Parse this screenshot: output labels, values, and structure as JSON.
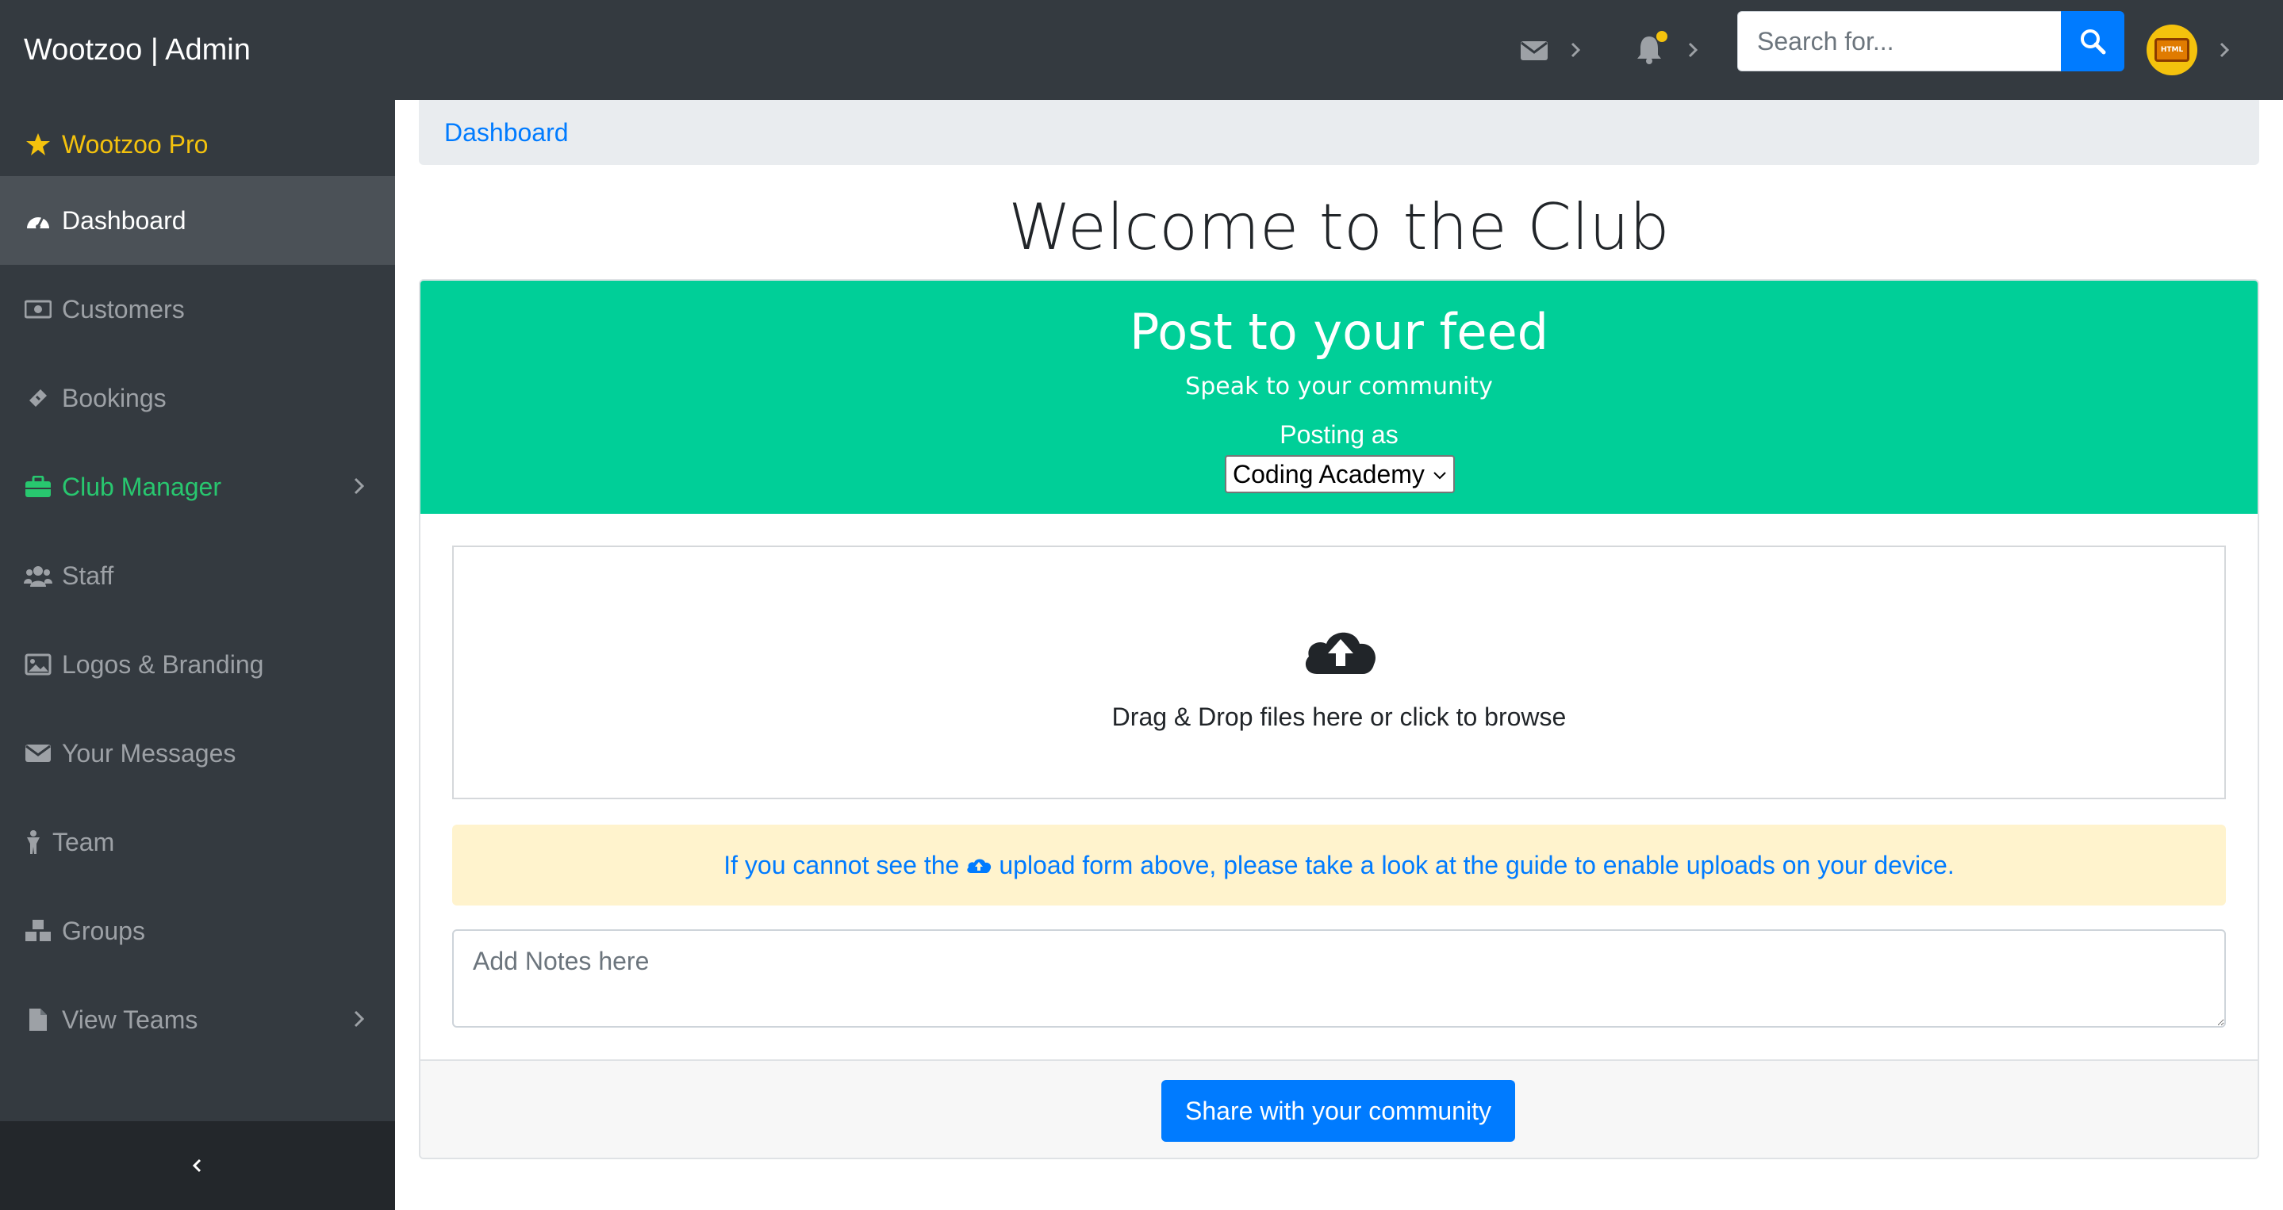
{
  "topbar": {
    "brand": "Wootzoo | Admin",
    "search_placeholder": "Search for...",
    "avatar_text": "HTML"
  },
  "sidebar": {
    "items": [
      {
        "label": "Wootzoo Pro",
        "icon": "star-icon"
      },
      {
        "label": "Dashboard",
        "icon": "tachometer-icon"
      },
      {
        "label": "Customers",
        "icon": "money-bill-icon"
      },
      {
        "label": "Bookings",
        "icon": "ticket-icon"
      },
      {
        "label": "Club Manager",
        "icon": "briefcase-icon"
      },
      {
        "label": "Staff",
        "icon": "users-icon"
      },
      {
        "label": "Logos & Branding",
        "icon": "image-icon"
      },
      {
        "label": "Your Messages",
        "icon": "envelope-icon"
      },
      {
        "label": "Team",
        "icon": "child-icon"
      },
      {
        "label": "Groups",
        "icon": "cubes-icon"
      },
      {
        "label": "View Teams",
        "icon": "file-icon"
      }
    ]
  },
  "breadcrumb": {
    "current": "Dashboard"
  },
  "main": {
    "welcome": "Welcome to the Club",
    "feed": {
      "title": "Post to your feed",
      "subtitle": "Speak to your community",
      "posting_as_label": "Posting as",
      "posting_as_value": "Coding Academy"
    },
    "dropzone_text": "Drag & Drop files here or click to browse",
    "alert": {
      "before": "If you cannot see the",
      "after": "upload form above, please take a look at the guide to enable uploads on your device."
    },
    "notes_placeholder": "Add Notes here",
    "share_button": "Share with your community"
  },
  "colors": {
    "topbar": "#343a40",
    "primary": "#007bff",
    "feed_header": "#00cf98",
    "pro": "#f4c20d",
    "club_manager": "#28c76f",
    "alert_bg": "#fff3cd"
  }
}
